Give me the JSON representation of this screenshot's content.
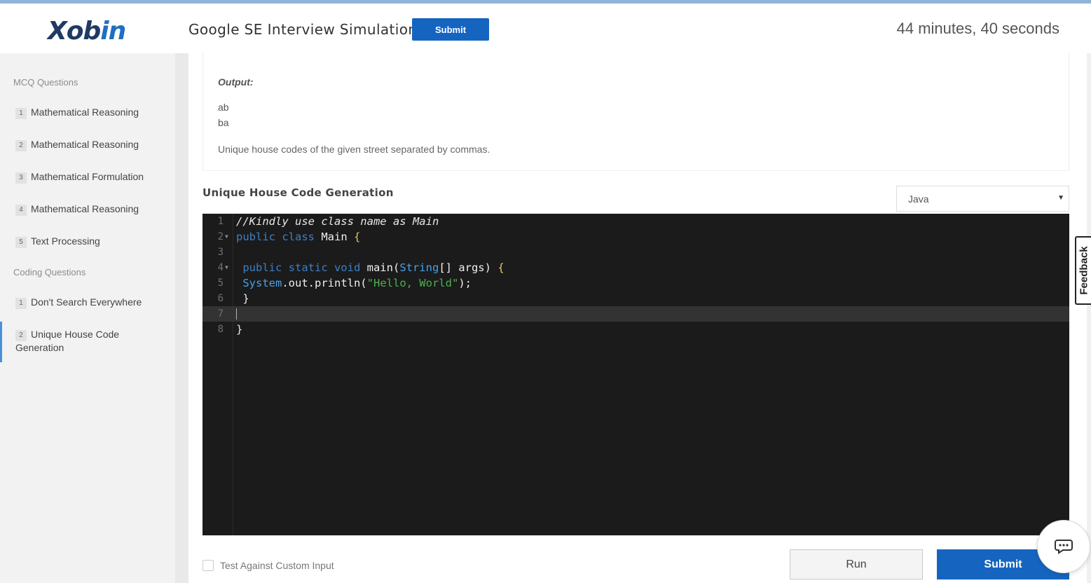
{
  "app": {
    "logo_main": "Xob",
    "logo_accent": "in"
  },
  "header": {
    "title": "Google SE Interview Simulation",
    "submit_label": "Submit",
    "timer": "44 minutes, 40 seconds"
  },
  "sidebar": {
    "mcq_label": "MCQ Questions",
    "mcq_items": [
      {
        "num": "1",
        "label": "Mathematical Reasoning"
      },
      {
        "num": "2",
        "label": "Mathematical Reasoning"
      },
      {
        "num": "3",
        "label": "Mathematical Formulation"
      },
      {
        "num": "4",
        "label": "Mathematical Reasoning"
      },
      {
        "num": "5",
        "label": "Text Processing"
      }
    ],
    "coding_label": "Coding Questions",
    "coding_items": [
      {
        "num": "1",
        "label": "Don't Search Everywhere"
      },
      {
        "num": "2",
        "label": "Unique House Code Generation",
        "active": true
      }
    ]
  },
  "problem": {
    "output_label": "Output:",
    "output_lines": [
      "ab",
      "ba"
    ],
    "note": "Unique house codes of the given street separated by commas."
  },
  "question": {
    "title": "Unique House Code Generation",
    "language": "Java"
  },
  "editor": {
    "line_numbers": [
      "1",
      "2",
      "3",
      "4",
      "5",
      "6",
      "7",
      "8"
    ],
    "current_line": 7,
    "code_lines": [
      "//Kindly use class name as Main",
      "public class Main {",
      "",
      " public static void main(String[] args) {",
      " System.out.println(\"Hello, World\");",
      " }",
      "",
      "}"
    ]
  },
  "controls": {
    "custom_input_label": "Test Against Custom Input",
    "run_label": "Run",
    "submit_label": "Submit"
  },
  "feedback_label": "Feedback",
  "colors": {
    "primary": "#1565c0",
    "logo_dark": "#1f3a63",
    "sidebar_bg": "#f2f2f2",
    "editor_bg": "#1b1b1b",
    "active_indicator": "#4a90d9"
  }
}
